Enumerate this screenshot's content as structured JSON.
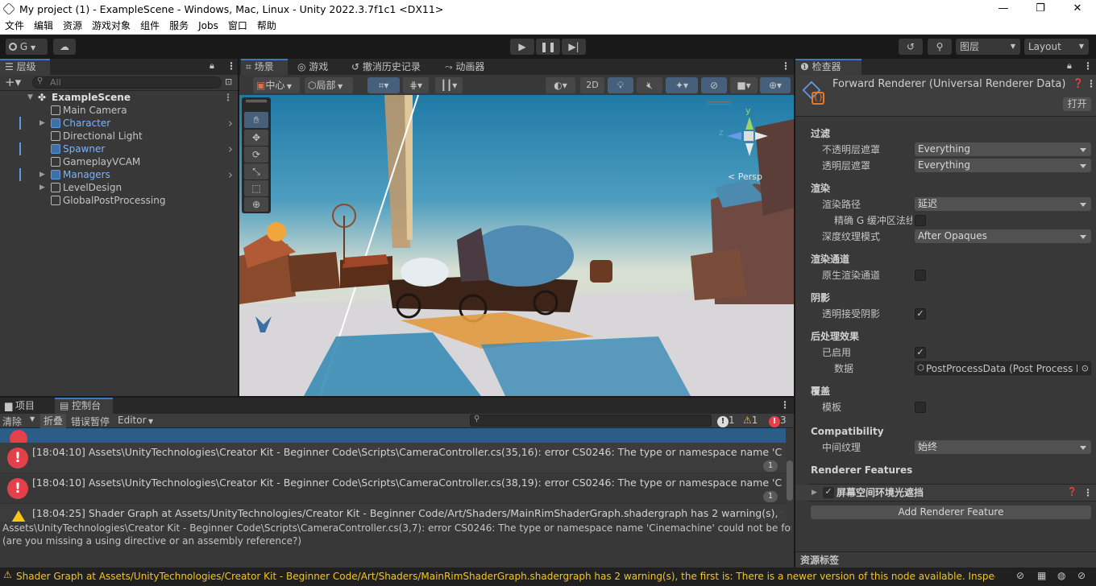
{
  "window": {
    "title": "My project (1) - ExampleScene - Windows, Mac, Linux - Unity 2022.3.7f1c1 <DX11>",
    "minimize": "—",
    "maximize": "❐",
    "close": "✕"
  },
  "menu": [
    "文件",
    "编辑",
    "资源",
    "游戏对象",
    "组件",
    "服务",
    "Jobs",
    "窗口",
    "帮助"
  ],
  "toolbar": {
    "account": "G",
    "layers": "图层",
    "layout": "Layout"
  },
  "hierarchy": {
    "tab": "层级",
    "search_placeholder": "All",
    "scene": "ExampleScene",
    "items": [
      {
        "label": "Main Camera",
        "prefab": false,
        "expandable": false
      },
      {
        "label": "Character",
        "prefab": true,
        "expandable": true
      },
      {
        "label": "Directional Light",
        "prefab": false,
        "expandable": false
      },
      {
        "label": "Spawner",
        "prefab": true,
        "expandable": false
      },
      {
        "label": "GameplayVCAM",
        "prefab": false,
        "expandable": false
      },
      {
        "label": "Managers",
        "prefab": true,
        "expandable": true
      },
      {
        "label": "LevelDesign",
        "prefab": false,
        "expandable": true
      },
      {
        "label": "GlobalPostProcessing",
        "prefab": false,
        "expandable": false
      }
    ]
  },
  "scene": {
    "tabs": [
      "场景",
      "游戏",
      "撤消历史记录",
      "动画器"
    ],
    "pivot": "中心",
    "space": "局部",
    "mode2d": "2D",
    "persp": "< Persp",
    "gizmo_y": "y",
    "gizmo_z": "z"
  },
  "inspector": {
    "tab": "检查器",
    "title": "Forward Renderer (Universal Renderer Data)",
    "open_button": "打开",
    "sections": {
      "filter": "过滤",
      "opaque_mask": "不透明层遮罩",
      "opaque_mask_value": "Everything",
      "transparent_mask": "透明层遮罩",
      "transparent_mask_value": "Everything",
      "rendering": "渲染",
      "render_path": "渲染路径",
      "render_path_value": "延迟",
      "accurate_gbuffer": "精确 G 缓冲区法线",
      "depth_mode": "深度纹理模式",
      "depth_mode_value": "After Opaques",
      "render_pass": "渲染通道",
      "native_pass": "原生渲染通道",
      "shadows": "阴影",
      "transparent_shadows": "透明接受阴影",
      "post": "后处理效果",
      "enabled": "已启用",
      "data": "数据",
      "data_value": "PostProcessData (Post Process Data)",
      "overrides": "覆盖",
      "stencil": "模板",
      "compat": "Compatibility",
      "intermediate": "中间纹理",
      "intermediate_value": "始终",
      "renderer_features": "Renderer Features",
      "ssao": "屏幕空间环境光遮挡",
      "add_feature": "Add Renderer Feature"
    },
    "asset_labels": "资源标签"
  },
  "console": {
    "tabs": [
      "项目",
      "控制台"
    ],
    "clear": "清除",
    "collapse": "折叠",
    "error_pause": "错误暂停",
    "editor": "Editor",
    "count_log": "1",
    "count_warn": "1",
    "count_err": "3",
    "rows": [
      {
        "text": "[18:04:10] Assets\\UnityTechnologies\\Creator Kit - Beginner Code\\Scripts\\CameraController.cs(35,16): error CS0246: The type or namespace name 'CinemachineVirtualCamera' could not be found",
        "count": "1",
        "type": "error"
      },
      {
        "text": "[18:04:10] Assets\\UnityTechnologies\\Creator Kit - Beginner Code\\Scripts\\CameraController.cs(38,19): error CS0246: The type or namespace name 'CinemachineFramingTransposer' could not be found",
        "count": "1",
        "type": "error"
      },
      {
        "text": "[18:04:25] Shader Graph at Assets/UnityTechnologies/Creator Kit - Beginner Code/Art/Shaders/MainRimShaderGraph.shadergraph has 2 warning(s), the first is: There is a newer version",
        "count": "",
        "type": "warning"
      }
    ],
    "detail_line1": "Assets\\UnityTechnologies\\Creator Kit - Beginner Code\\Scripts\\CameraController.cs(3,7): error CS0246: The type or namespace name 'Cinemachine' could not be found",
    "detail_line2": "(are you missing a using directive or an assembly reference?)"
  },
  "status": {
    "message": "Shader Graph at Assets/UnityTechnologies/Creator Kit - Beginner Code/Art/Shaders/MainRimShaderGraph.shadergraph has 2 warning(s), the first is: There is a newer version of this node available. Inspect node"
  },
  "colors": {
    "accent": "#3a79bb",
    "error": "#e2414a",
    "warning": "#f5c518",
    "prefab_text": "#7eb4f5"
  }
}
